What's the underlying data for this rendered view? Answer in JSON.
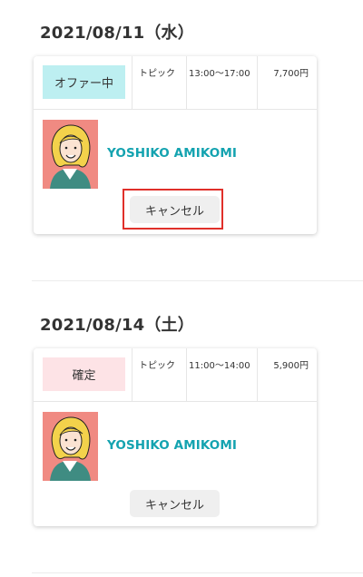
{
  "days": [
    {
      "date": "2021/08/11（水）",
      "status": {
        "label": "オファー中",
        "color": "#bdeff1"
      },
      "topic": "トピック",
      "time": "13:00〜17:00",
      "price": "7,700円",
      "user": {
        "name": "YOSHIKO AMIKOMI",
        "avatar": "woman-avatar-icon"
      },
      "cancel_label": "キャンセル",
      "cancel_highlighted": true
    },
    {
      "date": "2021/08/14（土）",
      "status": {
        "label": "確定",
        "color": "#fde3e6"
      },
      "topic": "トピック",
      "time": "11:00〜14:00",
      "price": "5,900円",
      "user": {
        "name": "YOSHIKO AMIKOMI",
        "avatar": "woman-avatar-icon"
      },
      "cancel_label": "キャンセル",
      "cancel_highlighted": false
    }
  ],
  "colors": {
    "accent_name": "#14a3b0",
    "highlight_border": "#e0302a",
    "avatar_bg": "#f08a82"
  }
}
